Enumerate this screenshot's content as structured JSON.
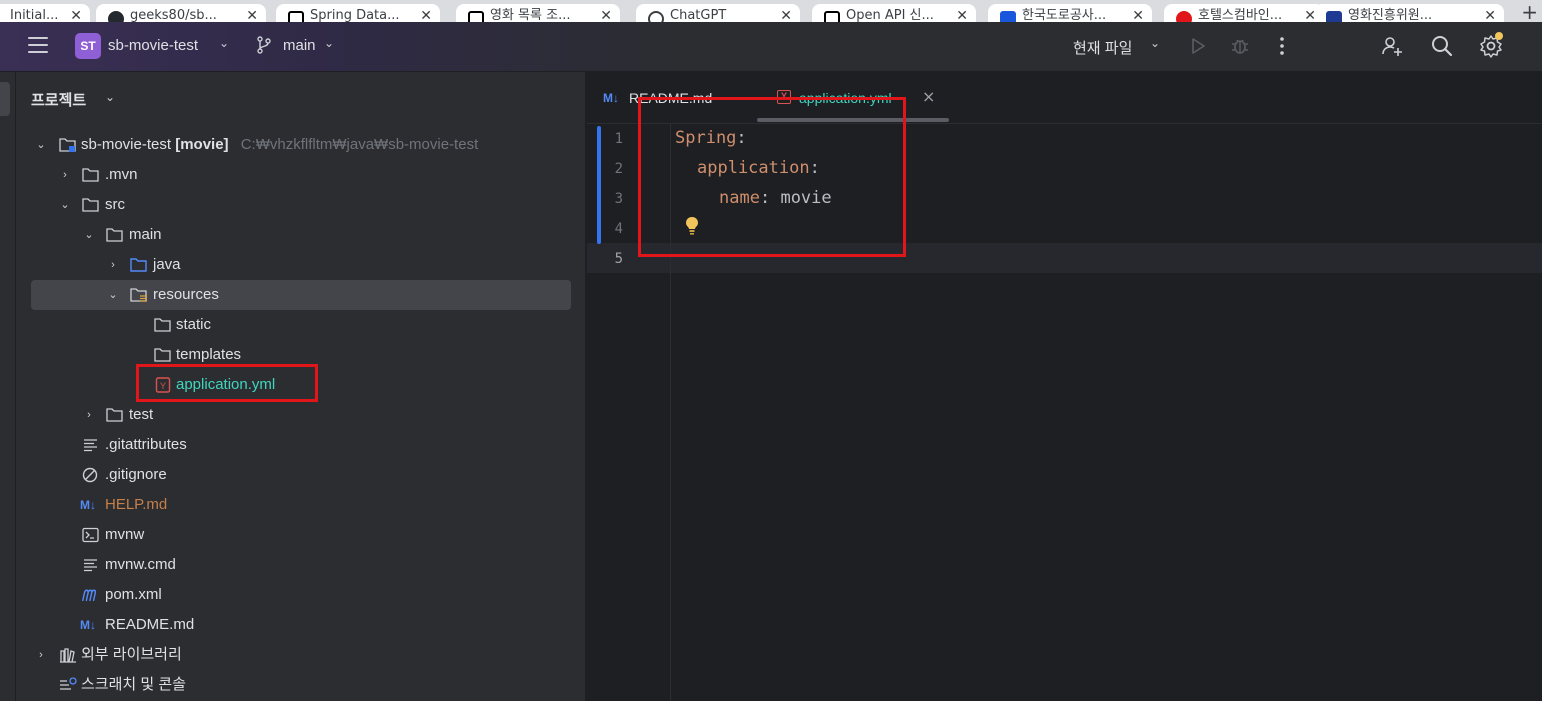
{
  "browser": {
    "tabs": [
      {
        "title": "Initial...",
        "favicon_color": "#5f6368"
      },
      {
        "title": "geeks80/sb...",
        "favicon_color": "#24292f"
      },
      {
        "title": "Spring Data...",
        "favicon_color": "#000000"
      },
      {
        "title": "영화 목록 조...",
        "favicon_color": "#000000"
      },
      {
        "title": "ChatGPT",
        "favicon_color": "#3c4043"
      },
      {
        "title": "Open API 신...",
        "favicon_color": "#000000"
      },
      {
        "title": "한국도로공사...",
        "favicon_color": "#1a56db"
      },
      {
        "title": "호텔스컴바인...",
        "favicon_color": "#e0161b"
      },
      {
        "title": "영화진흥위원...",
        "favicon_color": "#1f3a93"
      }
    ],
    "new_tab": "+"
  },
  "toolbar": {
    "project_badge": "ST",
    "project_name": "sb-movie-test",
    "branch": "main",
    "run_config": "현재 파일",
    "chevron": "⌄"
  },
  "project_panel": {
    "title": "프로젝트",
    "tree": [
      {
        "label": "sb-movie-test",
        "module": "[movie]",
        "path": "C:₩vhzkflfltm₩java₩sb-movie-test",
        "arrow": "⌄",
        "icon": "module-folder-icon"
      },
      {
        "label": ".mvn",
        "arrow": "›",
        "icon": "folder-icon"
      },
      {
        "label": "src",
        "arrow": "⌄",
        "icon": "folder-icon"
      },
      {
        "label": "main",
        "arrow": "⌄",
        "icon": "folder-icon"
      },
      {
        "label": "java",
        "arrow": "›",
        "icon": "source-folder-icon"
      },
      {
        "label": "resources",
        "arrow": "⌄",
        "icon": "resources-folder-icon"
      },
      {
        "label": "static",
        "arrow": "",
        "icon": "folder-icon"
      },
      {
        "label": "templates",
        "arrow": "",
        "icon": "folder-icon"
      },
      {
        "label": "application.yml",
        "arrow": "",
        "icon": "yaml-file-icon"
      },
      {
        "label": "test",
        "arrow": "›",
        "icon": "folder-icon"
      },
      {
        "label": ".gitattributes",
        "arrow": "",
        "icon": "text-file-icon"
      },
      {
        "label": ".gitignore",
        "arrow": "",
        "icon": "ignore-file-icon"
      },
      {
        "label": "HELP.md",
        "arrow": "",
        "icon": "markdown-file-icon"
      },
      {
        "label": "mvnw",
        "arrow": "",
        "icon": "shell-file-icon"
      },
      {
        "label": "mvnw.cmd",
        "arrow": "",
        "icon": "text-file-icon"
      },
      {
        "label": "pom.xml",
        "arrow": "",
        "icon": "maven-file-icon"
      },
      {
        "label": "README.md",
        "arrow": "",
        "icon": "markdown-file-icon"
      },
      {
        "label": "외부 라이브러리",
        "arrow": "›",
        "icon": "library-icon"
      },
      {
        "label": "스크래치 및 콘솔",
        "arrow": "",
        "icon": "scratches-icon"
      }
    ],
    "md_badge": "M↓",
    "yaml_badge": "Y"
  },
  "editor": {
    "tabs": [
      {
        "label": "README.md",
        "active": false
      },
      {
        "label": "application.yml",
        "active": true
      }
    ],
    "close_glyph": "×",
    "line_numbers": [
      "1",
      "2",
      "3",
      "4",
      "5"
    ],
    "code": {
      "l1_key": "Spring",
      "l2_key": "application",
      "l3_key": "name",
      "l3_value": "movie",
      "colon": ":"
    }
  }
}
